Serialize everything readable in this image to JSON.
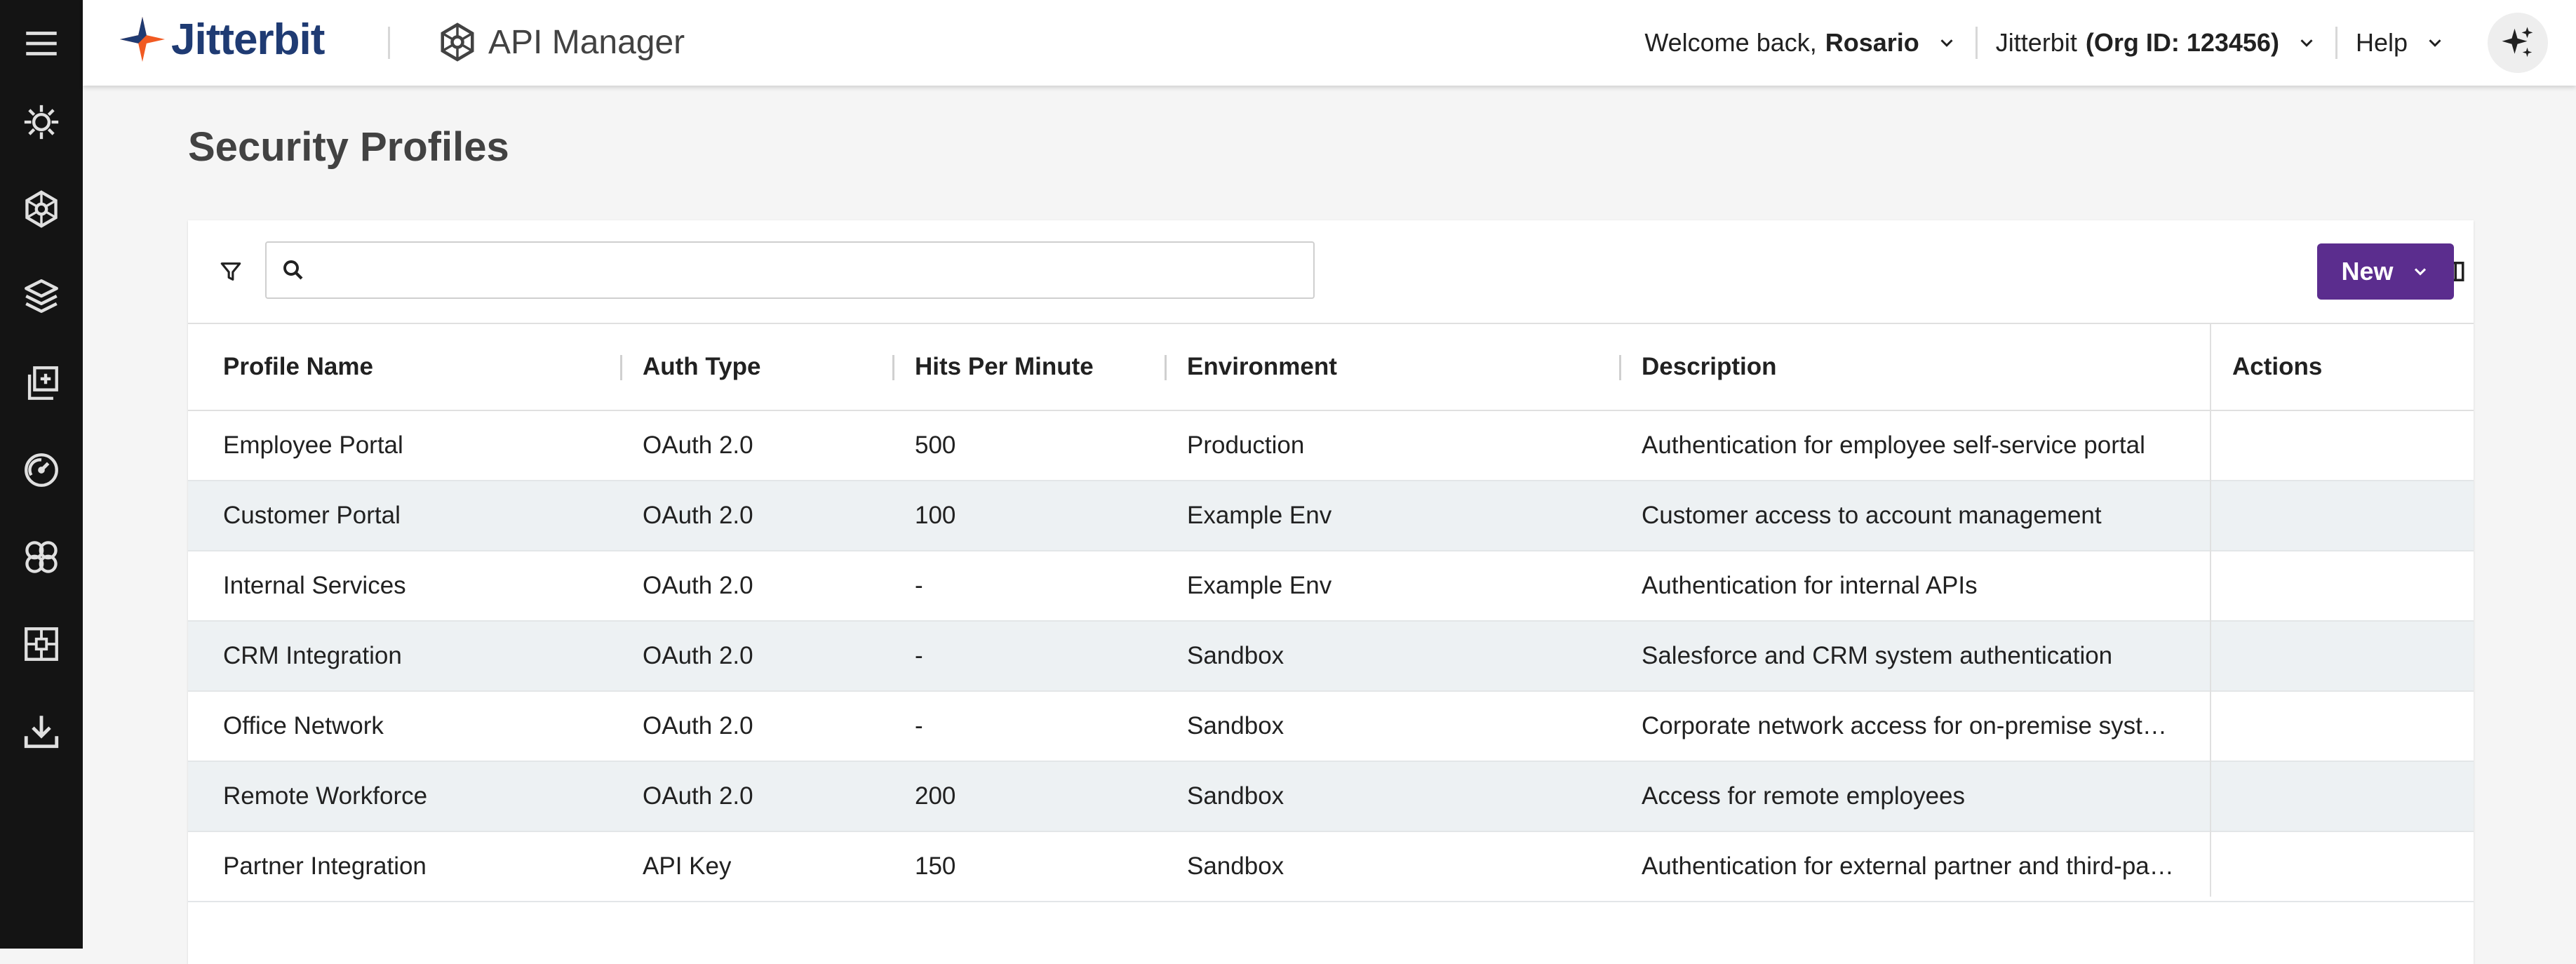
{
  "app": {
    "brand": "Jitterbit",
    "product": "API Manager"
  },
  "rail": {
    "items": [
      {
        "name": "menu-icon"
      },
      {
        "name": "integration-studio-icon"
      },
      {
        "name": "api-manager-icon"
      },
      {
        "name": "marketplace-icon"
      },
      {
        "name": "app-builder-icon"
      },
      {
        "name": "management-console-icon"
      },
      {
        "name": "wevo-icon"
      },
      {
        "name": "integration-hub-icon"
      },
      {
        "name": "downloads-icon"
      }
    ]
  },
  "header": {
    "welcome_prefix": "Welcome back,",
    "user_name": "Rosario",
    "org_name": "Jitterbit",
    "org_id": "(Org ID: 123456)",
    "help_label": "Help"
  },
  "page": {
    "title": "Security Profiles"
  },
  "toolbar": {
    "search_value": "",
    "new_label": "New"
  },
  "table": {
    "columns": [
      "Profile Name",
      "Auth Type",
      "Hits Per Minute",
      "Environment",
      "Description",
      "Actions"
    ],
    "rows": [
      {
        "name": "Employee Portal",
        "auth": "OAuth 2.0",
        "hits": "500",
        "env": "Production",
        "desc": "Authentication for employee self-service portal"
      },
      {
        "name": "Customer Portal",
        "auth": "OAuth 2.0",
        "hits": "100",
        "env": "Example Env",
        "desc": "Customer access to account management"
      },
      {
        "name": "Internal Services",
        "auth": "OAuth 2.0",
        "hits": "-",
        "env": "Example Env",
        "desc": "Authentication for internal APIs"
      },
      {
        "name": "CRM Integration",
        "auth": "OAuth 2.0",
        "hits": "-",
        "env": "Sandbox",
        "desc": "Salesforce and CRM system authentication"
      },
      {
        "name": "Office Network",
        "auth": "OAuth 2.0",
        "hits": "-",
        "env": "Sandbox",
        "desc": "Corporate network access for on-premise systems"
      },
      {
        "name": "Remote Workforce",
        "auth": "OAuth 2.0",
        "hits": "200",
        "env": "Sandbox",
        "desc": "Access for remote employees"
      },
      {
        "name": "Partner Integration",
        "auth": "API Key",
        "hits": "150",
        "env": "Sandbox",
        "desc": "Authentication for external partner and third-party access"
      }
    ]
  },
  "colors": {
    "rail_bg": "#141414",
    "brand_orange": "#f15a22",
    "brand_navy": "#1f3b73",
    "primary_button": "#5b2d8e",
    "alt_row": "#edf1f3"
  }
}
